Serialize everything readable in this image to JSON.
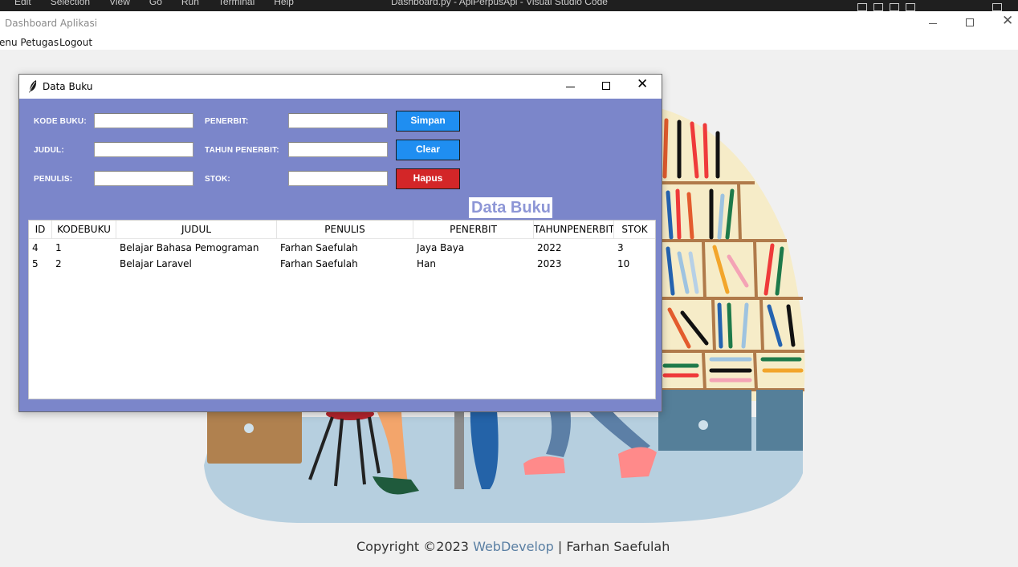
{
  "vscode": {
    "menu": [
      "Edit",
      "Selection",
      "View",
      "Go",
      "Run",
      "Terminal",
      "Help"
    ],
    "title": "Dashboard.py - AplPerpusApi - Visual Studio Code"
  },
  "dashboard": {
    "title": "Dashboard Aplikasi",
    "menu": [
      "enu Petugas",
      "Logout"
    ],
    "copyright": {
      "prefix": "Copyright ©2023 ",
      "link": "WebDevelop",
      "suffix": " | Farhan Saefulah"
    }
  },
  "window": {
    "title": "Data Buku",
    "form": {
      "kode_buku_label": "KODE BUKU:",
      "judul_label": "JUDUL:",
      "penulis_label": "PENULIS:",
      "penerbit_label": "PENERBIT:",
      "tahun_penerbit_label": "TAHUN PENERBIT:",
      "stok_label": "STOK:",
      "kode_buku_value": "",
      "judul_value": "",
      "penulis_value": "",
      "penerbit_value": "",
      "tahun_penerbit_value": "",
      "stok_value": ""
    },
    "buttons": {
      "simpan": "Simpan",
      "clear": "Clear",
      "hapus": "Hapus"
    },
    "heading": "Data Buku",
    "table": {
      "columns": [
        "ID",
        "KODEBUKU",
        "JUDUL",
        "PENULIS",
        "PENERBIT",
        "TAHUNPENERBIT",
        "STOK"
      ],
      "rows": [
        [
          "4",
          "1",
          "Belajar Bahasa Pemograman",
          "Farhan Saefulah",
          "Jaya Baya",
          "2022",
          "3"
        ],
        [
          "5",
          "2",
          "Belajar Laravel",
          "Farhan Saefulah",
          "Han",
          "2023",
          "10"
        ]
      ]
    }
  },
  "colors": {
    "window_bg": "#7b86ca",
    "button_blue": "#1f8ef1",
    "button_red": "#d32628",
    "heading": "#8d96d6"
  }
}
